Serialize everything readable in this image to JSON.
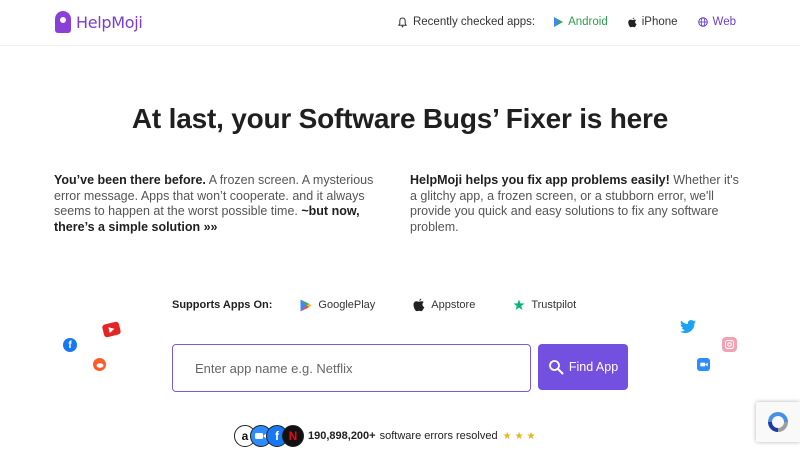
{
  "header": {
    "logo_text": "HelpMoji",
    "recently_checked_label": "Recently checked apps:",
    "platforms": [
      "Android",
      "iPhone",
      "Web"
    ]
  },
  "hero": {
    "title": "At last, your Software Bugs’ Fixer is here",
    "left_bold": "You’ve been there before.",
    "left_text": " A frozen screen. A mysterious error message. Apps that won’t cooperate. and it always seems to happen at the worst possible time. ",
    "left_bold_end": "~but now, there’s a simple solution »»",
    "right_bold": "HelpMoji helps you fix app problems easily!",
    "right_text": " Whether it's a glitchy app, a frozen screen, or a stubborn error, we'll provide you quick and easy solutions to fix any software problem."
  },
  "supports": {
    "label": "Supports Apps On:",
    "stores": [
      "GooglePlay",
      "Appstore",
      "Trustpilot"
    ]
  },
  "search": {
    "placeholder": "Enter app name e.g. Netflix",
    "button_label": "Find App"
  },
  "stats": {
    "count": "190,898,200+",
    "text": "software errors resolved",
    "stars": "★★★"
  },
  "colors": {
    "brand_purple": "#7350e0",
    "logo_purple": "#8b3fd9",
    "android_green": "#2e9e4f"
  },
  "floating_icons": [
    "facebook-icon",
    "youtube-icon",
    "reddit-icon",
    "twitter-icon",
    "instagram-icon",
    "zoom-icon"
  ]
}
